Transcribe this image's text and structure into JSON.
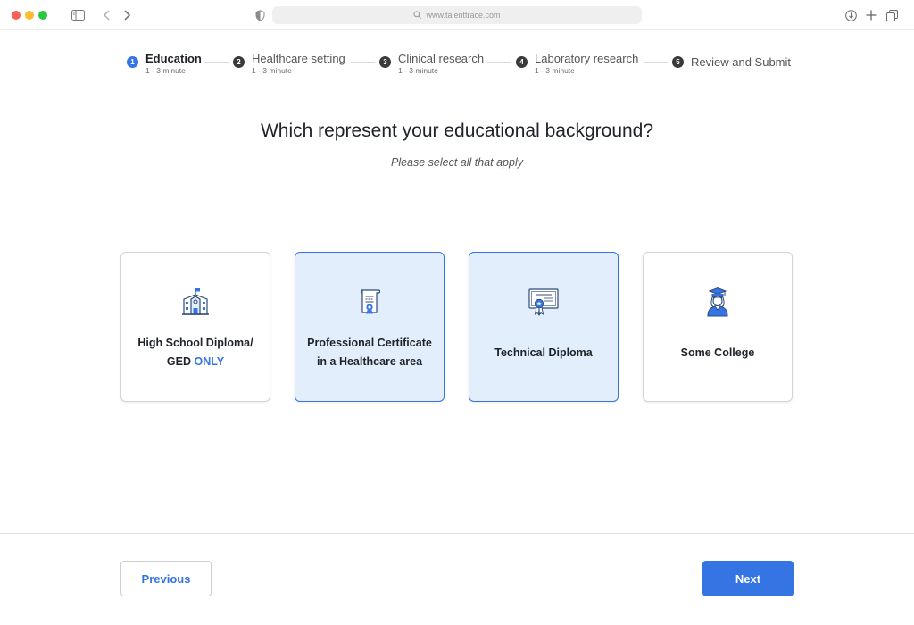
{
  "browser": {
    "url": "www.talenttrace.com"
  },
  "stepper": {
    "steps": [
      {
        "number": "1",
        "title": "Education",
        "subtitle": "1 - 3 minute"
      },
      {
        "number": "2",
        "title": "Healthcare setting",
        "subtitle": "1 - 3 minute"
      },
      {
        "number": "3",
        "title": "Clinical research",
        "subtitle": "1 - 3 minute"
      },
      {
        "number": "4",
        "title": "Laboratory research",
        "subtitle": "1 - 3 minute"
      },
      {
        "number": "5",
        "title": "Review and Submit",
        "subtitle": ""
      }
    ],
    "active_step": 1
  },
  "question": {
    "title": "Which represent your educational background?",
    "hint": "Please select all that apply"
  },
  "options": [
    {
      "line1": "High School Diploma/",
      "line2_prefix": "GED ",
      "line2_highlight": "ONLY",
      "icon": "school-building-icon",
      "selected": false
    },
    {
      "line1": "Professional Certificate",
      "line2": "in a Healthcare area",
      "icon": "certificate-scroll-icon",
      "selected": true
    },
    {
      "line1": "Technical Diploma",
      "icon": "diploma-award-icon",
      "selected": true
    },
    {
      "line1": "Some College",
      "icon": "graduate-student-icon",
      "selected": false
    }
  ],
  "footer": {
    "previous_label": "Previous",
    "next_label": "Next"
  },
  "colors": {
    "accent": "#3574e3",
    "selected_bg": "#e3eefc"
  }
}
